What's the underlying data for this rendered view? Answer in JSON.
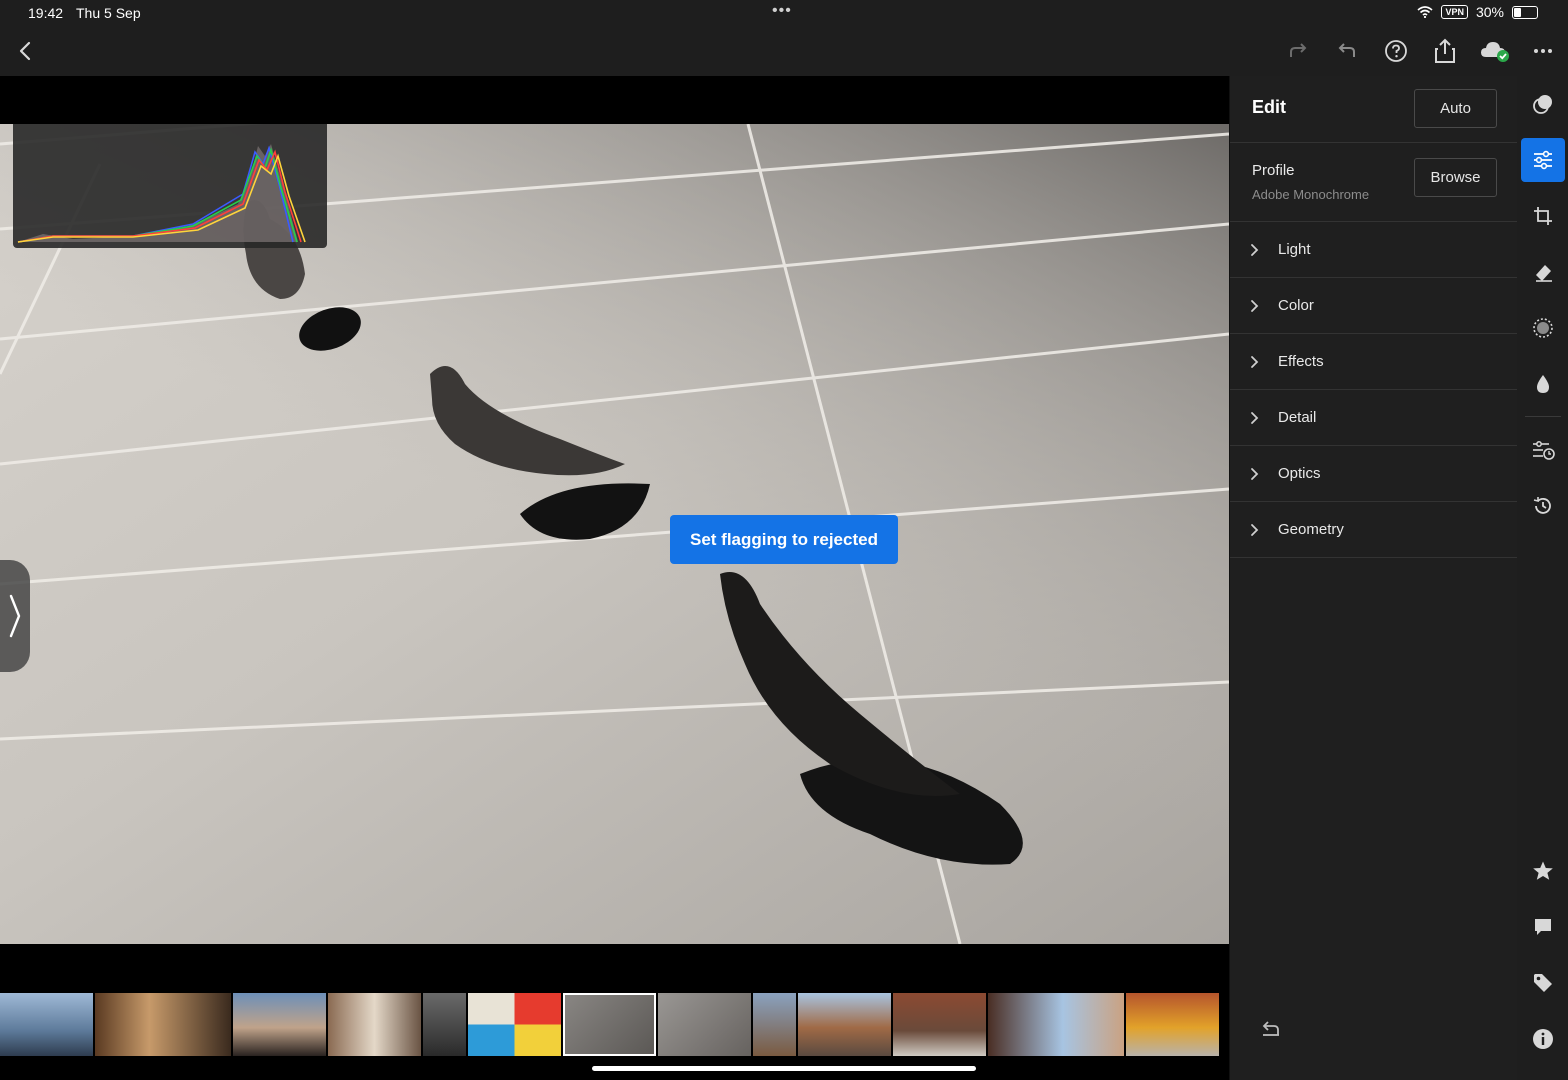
{
  "status_bar": {
    "time": "19:42",
    "date": "Thu 5 Sep",
    "vpn_badge": "VPN",
    "battery_percent": "30%",
    "battery_level": 0.3
  },
  "toolbar": {
    "icons": [
      "back-icon",
      "redo-icon",
      "undo-icon",
      "help-icon",
      "share-icon",
      "cloud-sync-icon",
      "more-icon"
    ]
  },
  "viewer": {
    "toast": "Set flagging to rejected",
    "filmstrip_count": 13,
    "selected_index": 6
  },
  "edit_panel": {
    "title": "Edit",
    "auto_label": "Auto",
    "profile": {
      "label": "Profile",
      "value": "Adobe Monochrome",
      "browse_label": "Browse"
    },
    "sections": [
      {
        "label": "Light"
      },
      {
        "label": "Color"
      },
      {
        "label": "Effects"
      },
      {
        "label": "Detail"
      },
      {
        "label": "Optics"
      },
      {
        "label": "Geometry"
      }
    ]
  },
  "rail": {
    "items": [
      "presets-icon",
      "edit-sliders-icon",
      "crop-icon",
      "healing-eraser-icon",
      "masking-icon",
      "color-drop-icon",
      "versions-icon",
      "history-icon",
      "rating-star-icon",
      "comments-icon",
      "keywords-tag-icon",
      "info-icon"
    ],
    "active": "edit-sliders-icon"
  },
  "colors": {
    "accent": "#1473e6",
    "panel_bg": "#1f1f1f",
    "divider": "#333333"
  }
}
